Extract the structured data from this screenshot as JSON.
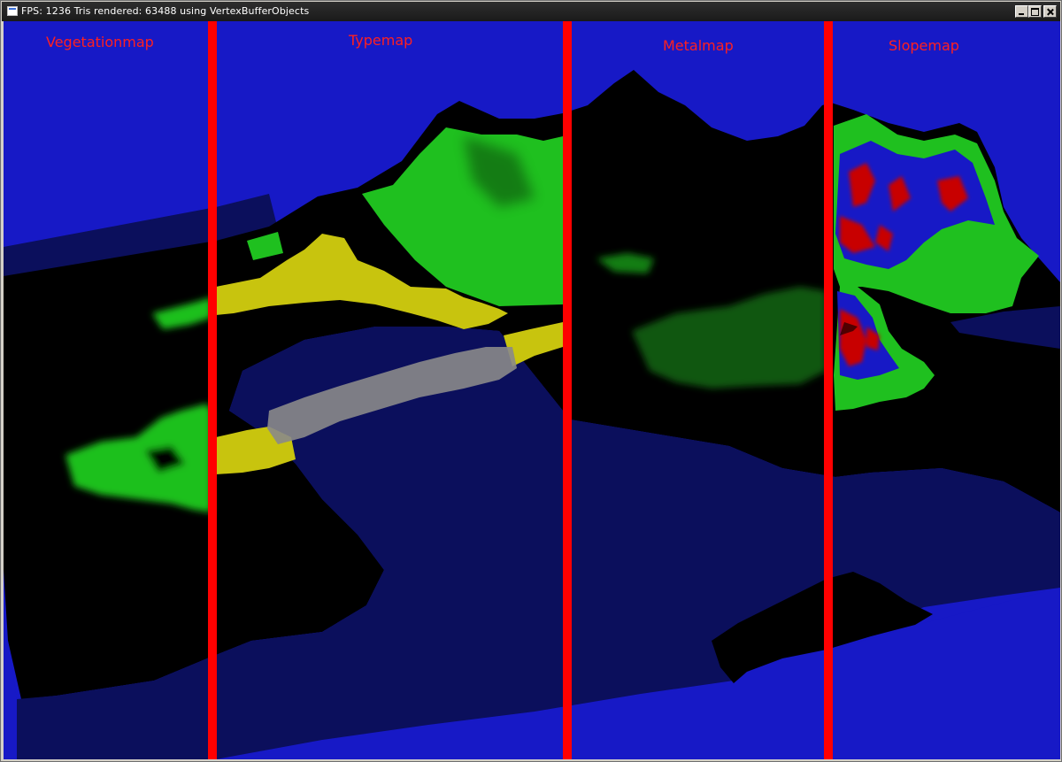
{
  "window": {
    "title": "FPS: 1236  Tris rendered: 63488 using VertexBufferObjects",
    "controls": {
      "minimize": "minimize",
      "maximize": "maximize",
      "close": "close"
    }
  },
  "viewport": {
    "labels": {
      "vegetation": "Vegetationmap",
      "type": "Typemap",
      "metal": "Metalmap",
      "slope": "Slopemap"
    }
  },
  "colors": {
    "sky": "#1719c6",
    "water": "#0b0f5c",
    "terrain_dark": "#000000",
    "vegetation_green": "#1fc01f",
    "type_yellow": "#c8c40e",
    "type_gray": "#808080",
    "slope_red": "#c80000",
    "divider": "#ff0000",
    "label": "#ff2020"
  }
}
